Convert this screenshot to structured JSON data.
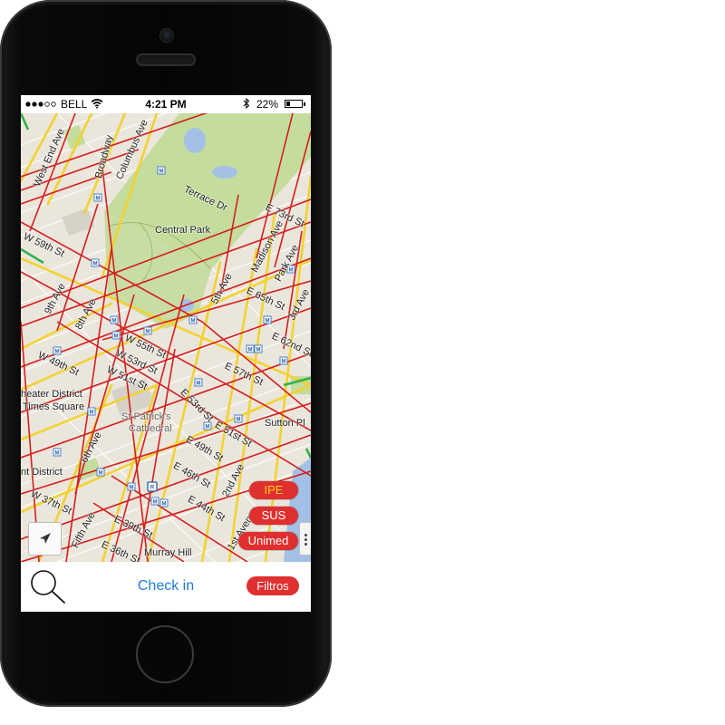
{
  "status_bar": {
    "carrier": "BELL",
    "time": "4:21 PM",
    "battery": "22%",
    "battery_level": 0.22,
    "signal_bars_filled": 3,
    "signal_bars_total": 5
  },
  "map": {
    "labels": {
      "west_end_ave": "West End Ave",
      "broadway": "Broadway",
      "columbus_ave": "Columbus Ave",
      "terrace_dr": "Terrace Dr",
      "central_park": "Central Park",
      "e_73rd_st": "E 73rd St",
      "madison_ave": "Madison Ave",
      "park_ave": "Park Ave",
      "w_59th_st": "W 59th St",
      "fifth_ave_upper": "5th Ave",
      "e_65th_st": "E 65th St",
      "third_ave": "3rd Ave",
      "ninth_ave": "9th Ave",
      "eighth_ave": "8th Ave",
      "e_62nd_st": "E 62nd St",
      "w_55th_st": "W 55th St",
      "w_53rd_st": "W 53rd St",
      "w_49th_st": "W 49th St",
      "w_51st_st": "W 51st St",
      "e_57th_st": "E 57th St",
      "e_53rd_st": "E 53rd St",
      "theater_district": "heater District",
      "times_square": "Times Square",
      "st_patricks": "St Patrick's",
      "cathedral": "Cathedral",
      "sutton_pl": "Sutton Pl",
      "e_51st_st": "E 51st St",
      "e_49th_st": "E 49th St",
      "sixth_ave": "6th Ave",
      "garment_district": "nt District",
      "e_46th_st": "E 46th St",
      "second_ave": "2nd Ave",
      "w_37th_st": "W 37th St",
      "e_44th_st": "E 44th St",
      "fifth_avenue": "Fifth Ave",
      "e_39th_st": "E 39th St",
      "first_avenue": "1st Avenue",
      "e_36th_st": "E 36th St",
      "murray_hill": "Murray Hill"
    }
  },
  "filters": {
    "ipe": "IPE",
    "sus": "SUS",
    "unimed": "Unimed"
  },
  "bottom_bar": {
    "checkin": "Check in",
    "filtros": "Filtros"
  },
  "icons": {
    "search": "search-icon",
    "locate": "location-arrow-icon",
    "wifi": "wifi-icon",
    "bluetooth": "bluetooth-icon",
    "battery": "battery-icon",
    "metro": "metro-icon"
  },
  "colors": {
    "pill_red": "#e02f2f",
    "ipe_text": "#ffd21e",
    "link_blue": "#1f7bd6",
    "park_green": "#c4dc9c",
    "water": "#a3c1e6",
    "traffic_red": "#d41f1f",
    "traffic_yellow": "#f3d230",
    "traffic_green": "#2fb34a"
  }
}
